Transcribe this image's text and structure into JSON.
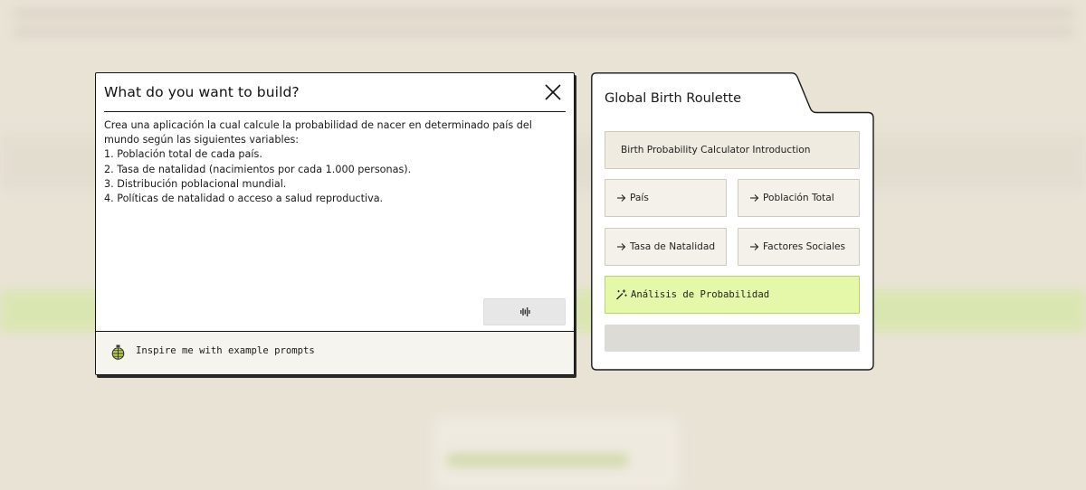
{
  "dialog": {
    "title": "What do you want to build?",
    "prompt_text": "Crea una aplicación la cual calcule la probabilidad de nacer en determinado país del mundo según las siguientes variables:\n1. Población total de cada país.\n2. Tasa de natalidad (nacimientos por cada 1.000 personas).\n3. Distribución poblacional mundial.\n4. Políticas de natalidad o acceso a salud reproductiva.",
    "voice_button_icon": "waveform-icon",
    "inspire_label": "Inspire me with example prompts",
    "inspire_icon": "grenade-icon"
  },
  "panel": {
    "app_title": "Global Birth Roulette",
    "intro": "Birth Probability Calculator Introduction",
    "items": [
      {
        "label": "País",
        "icon": "arrow-right-icon"
      },
      {
        "label": "Población Total",
        "icon": "arrow-right-icon"
      },
      {
        "label": "Tasa de Natalidad",
        "icon": "arrow-right-icon"
      },
      {
        "label": "Factores Sociales",
        "icon": "arrow-right-icon"
      }
    ],
    "active_item": {
      "label": "Análisis de Probabilidad",
      "icon": "sparkle-wand-icon"
    }
  },
  "colors": {
    "background": "#e9e3d6",
    "active_green": "#e5f8a9",
    "border_dark": "#141414",
    "tile_bg": "#f4f1ea"
  }
}
